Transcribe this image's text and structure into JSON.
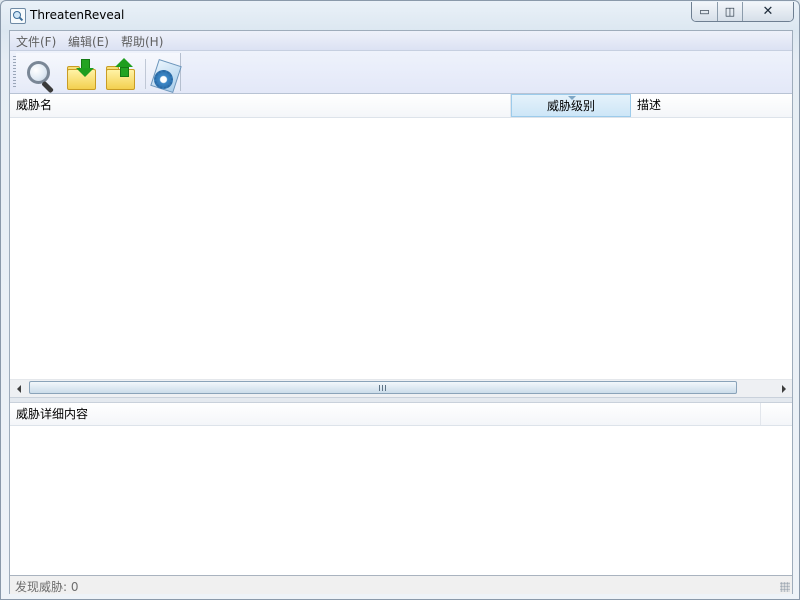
{
  "window": {
    "title": "ThreatenReveal",
    "app_icon": "magnifier-app-icon",
    "controls": {
      "minimize": "▭",
      "maximize": "◫",
      "close": "✕"
    }
  },
  "menu": {
    "items": [
      {
        "label": "文件(F)"
      },
      {
        "label": "编辑(E)"
      },
      {
        "label": "帮助(H)"
      }
    ]
  },
  "toolbar": {
    "buttons": [
      {
        "icon": "magnifier-icon"
      },
      {
        "icon": "folder-import-icon"
      },
      {
        "icon": "folder-export-icon"
      },
      {
        "icon": "info-settings-icon"
      }
    ]
  },
  "threat_list": {
    "columns": [
      {
        "label": "威胁名"
      },
      {
        "label": "威胁级别",
        "sorted": true
      },
      {
        "label": "描述"
      }
    ],
    "rows": []
  },
  "detail_panel": {
    "header": "威胁详细内容",
    "content": ""
  },
  "status": {
    "text": "发现威胁: 0"
  },
  "colors": {
    "selected_header": "#cde6f7",
    "menubar": "#dce2f3",
    "toolbar": "#e3e8f8"
  }
}
